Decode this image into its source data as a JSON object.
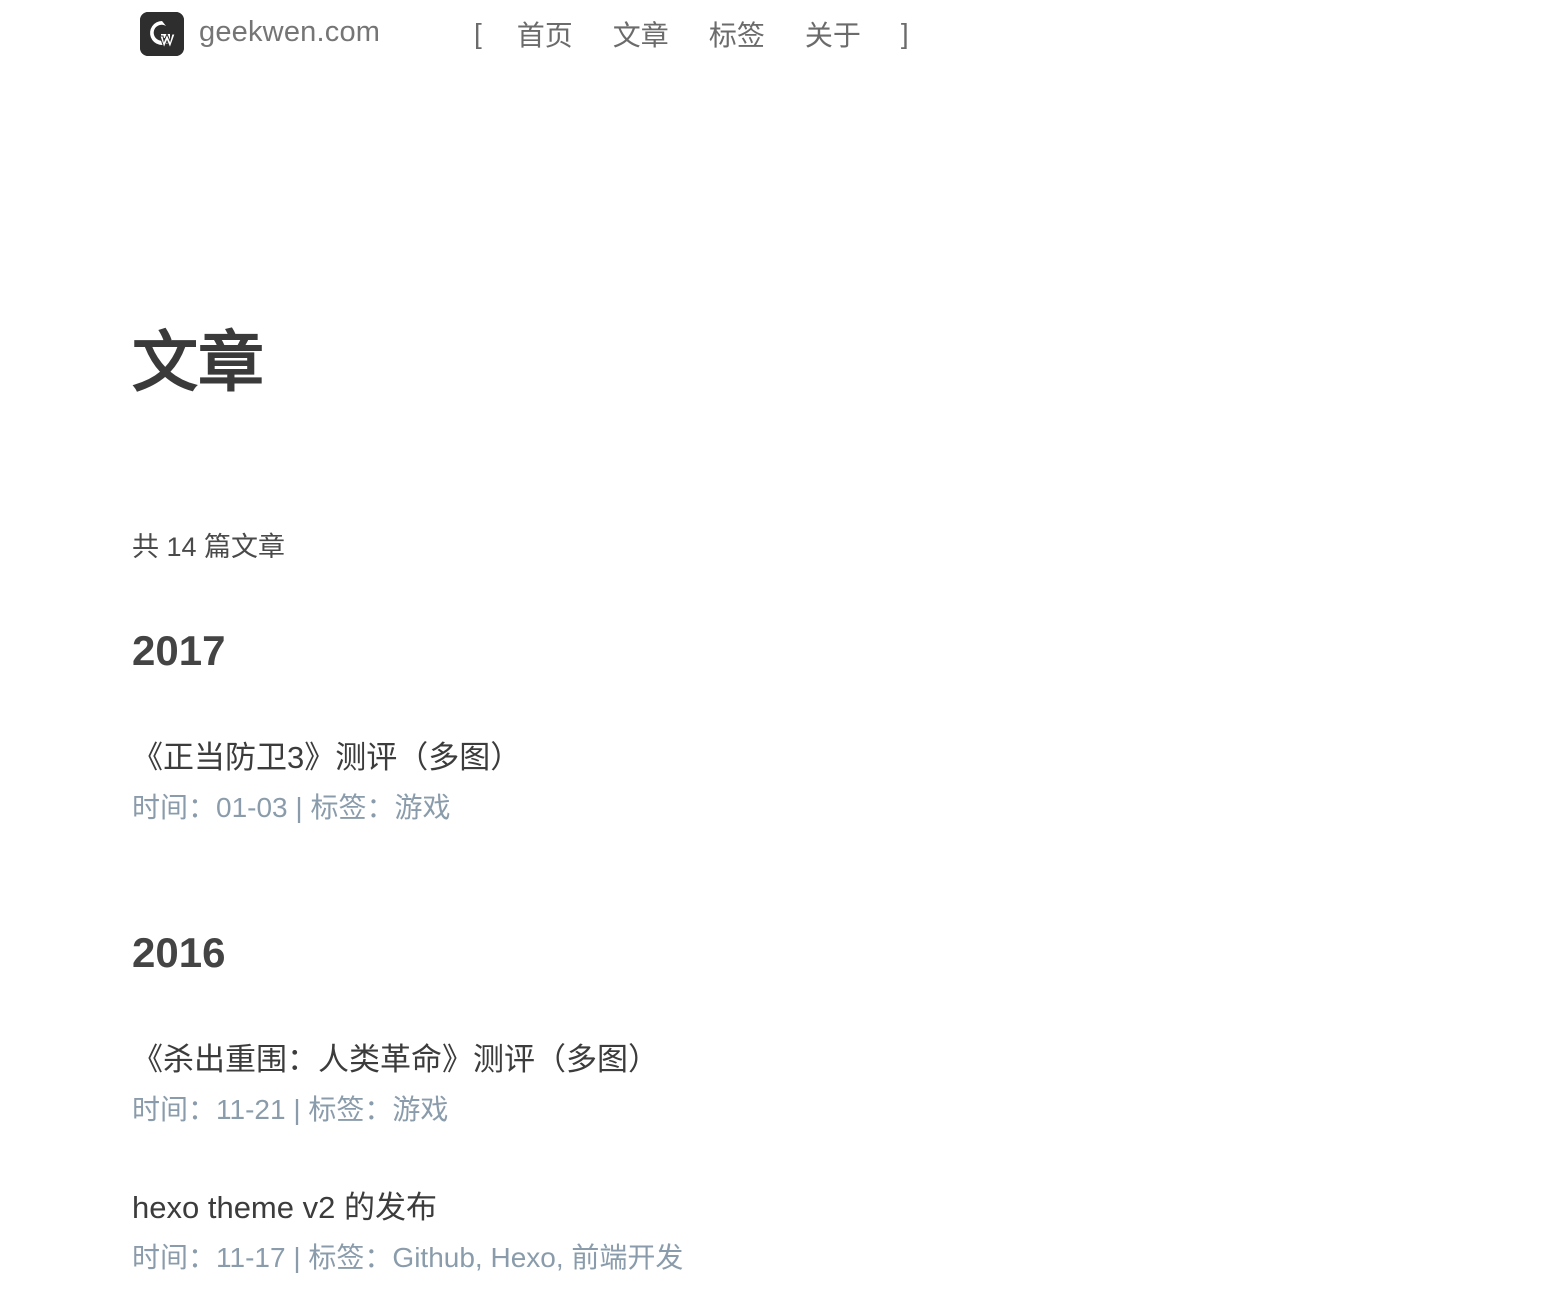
{
  "header": {
    "site_name": "geekwen.com",
    "nav_open_bracket": "[",
    "nav_close_bracket": "]",
    "nav": [
      {
        "label": "首页"
      },
      {
        "label": "文章"
      },
      {
        "label": "标签"
      },
      {
        "label": "关于"
      }
    ]
  },
  "page": {
    "title": "文章",
    "post_count_text": "共 14 篇文章"
  },
  "archive": [
    {
      "year": "2017",
      "posts": [
        {
          "title": "《正当防卫3》测评（多图）",
          "time_label": "时间：",
          "date": "01-03",
          "separator": " | ",
          "tags_label": "标签：",
          "tags": [
            "游戏"
          ]
        }
      ]
    },
    {
      "year": "2016",
      "posts": [
        {
          "title": "《杀出重围：人类革命》测评（多图）",
          "time_label": "时间：",
          "date": "11-21",
          "separator": " | ",
          "tags_label": "标签：",
          "tags": [
            "游戏"
          ]
        },
        {
          "title": "hexo theme v2 的发布",
          "time_label": "时间：",
          "date": "11-17",
          "separator": " | ",
          "tags_label": "标签：",
          "tags": [
            "Github",
            "Hexo",
            "前端开发"
          ],
          "tag_separator": ", "
        }
      ]
    }
  ],
  "colors": {
    "meta": "#8a9cab",
    "logo_bg": "#2e2e2e"
  }
}
